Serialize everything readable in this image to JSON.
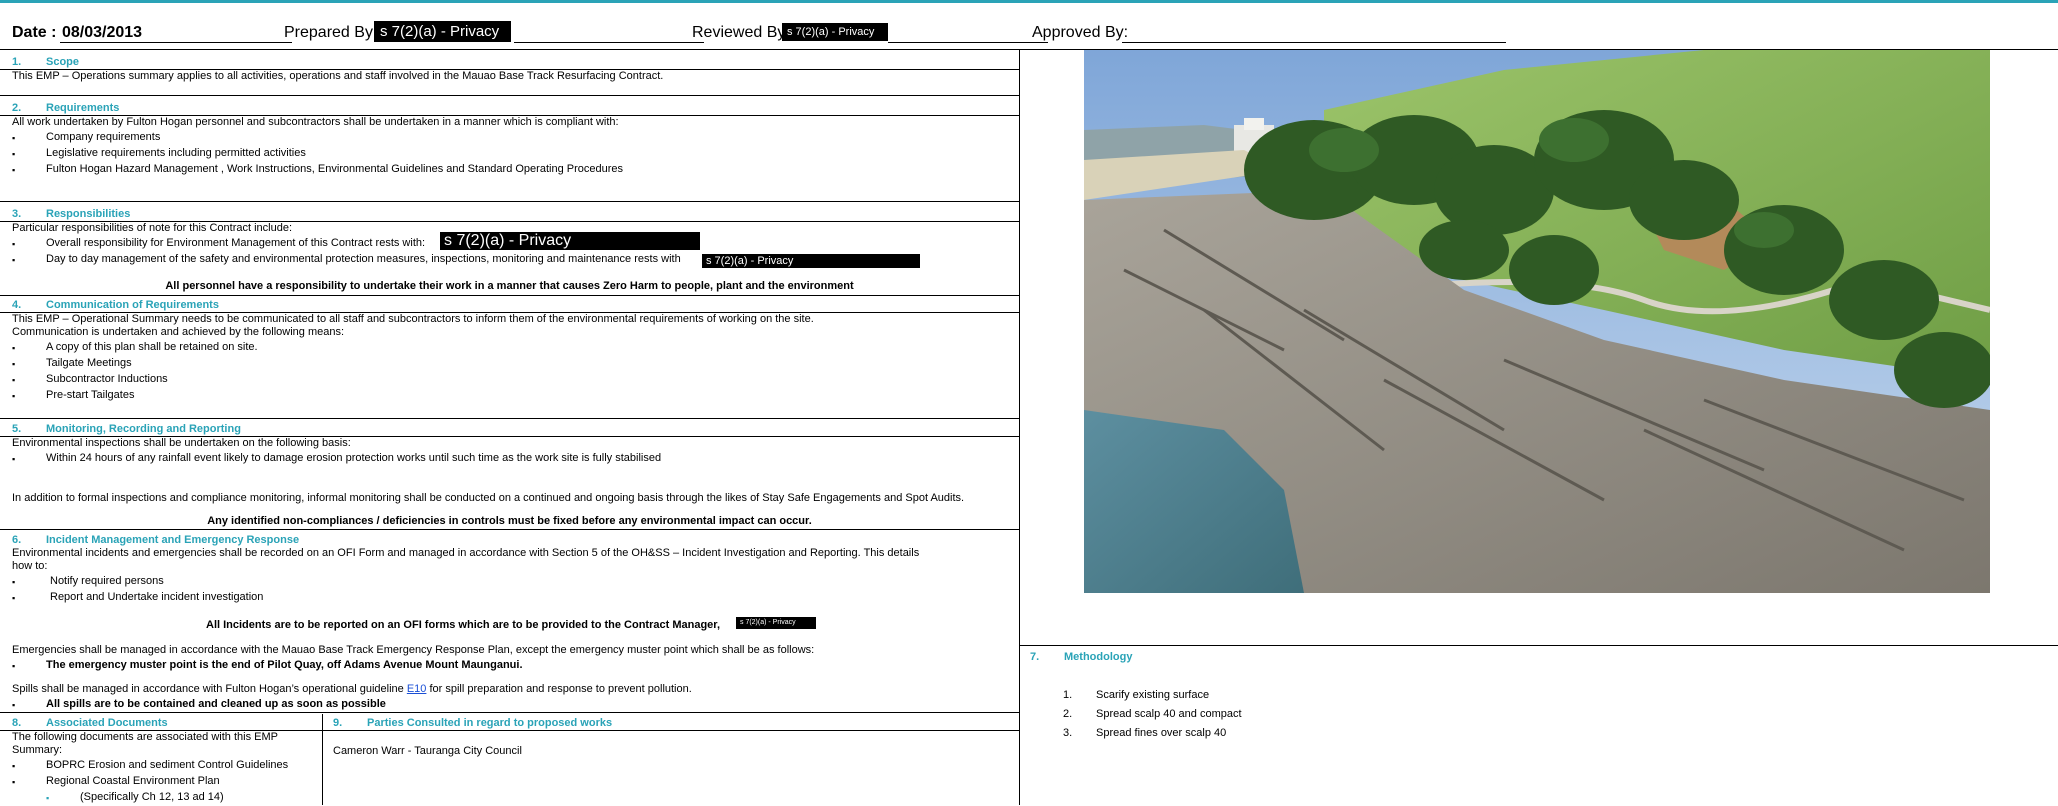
{
  "header": {
    "date_label": "Date :",
    "date_value": "08/03/2013",
    "prepared_label": "Prepared By:",
    "prepared_redaction": "s 7(2)(a) - Privacy",
    "reviewed_label": "Reviewed By",
    "reviewed_redaction": "s 7(2)(a) - Privacy",
    "approved_label": "Approved By:"
  },
  "sections": {
    "scope": {
      "num": "1.",
      "title": "Scope",
      "text": "This EMP – Operations summary applies to all activities, operations and staff involved in the Mauao Base Track Resurfacing Contract."
    },
    "requirements": {
      "num": "2.",
      "title": "Requirements",
      "intro": "All work undertaken by Fulton Hogan personnel and subcontractors shall be undertaken in a manner which is compliant with:",
      "items": [
        "Company requirements",
        "Legislative requirements including permitted activities",
        "Fulton Hogan Hazard Management , Work Instructions, Environmental Guidelines and Standard Operating Procedures"
      ]
    },
    "responsibilities": {
      "num": "3.",
      "title": "Responsibilities",
      "intro": "Particular responsibilities of note for this Contract include:",
      "items": [
        "Overall responsibility for Environment Management of this Contract rests with:",
        "Day to day management of the safety and environmental protection measures, inspections, monitoring and maintenance rests with"
      ],
      "redaction1": "s 7(2)(a) - Privacy",
      "redaction2": "s 7(2)(a) - Privacy",
      "statement": "All personnel have a responsibility to undertake their work in a manner that causes Zero Harm to people, plant and the environment"
    },
    "communication": {
      "num": "4.",
      "title": "Communication of Requirements",
      "line1": "This EMP – Operational Summary needs to be communicated to all staff and subcontractors to inform them of the environmental requirements of working on the site.",
      "line2": "Communication is undertaken and achieved by the following means:",
      "items": [
        "A copy of this plan shall be retained on site.",
        "Tailgate Meetings",
        "Subcontractor Inductions",
        "Pre-start Tailgates"
      ]
    },
    "monitoring": {
      "num": "5.",
      "title": "Monitoring, Recording and Reporting",
      "intro": "Environmental inspections shall be undertaken on the following basis:",
      "items": [
        "Within 24 hours of any rainfall event likely to damage erosion protection works until such time as the work site is fully stabilised"
      ],
      "para": "In addition to formal inspections and compliance monitoring, informal monitoring shall be conducted on a continued and ongoing basis through the likes of Stay Safe Engagements and Spot Audits.",
      "statement": "Any identified non-compliances / deficiencies in controls must be fixed before any environmental impact can occur."
    },
    "incident": {
      "num": "6.",
      "title": "Incident Management and Emergency Response",
      "line1": "Environmental incidents and emergencies shall be recorded on an OFI Form and managed in accordance with Section 5 of the OH&SS – Incident Investigation and Reporting. This details",
      "line2": "how to:",
      "items": [
        "Notify required persons",
        "Report and  Undertake incident investigation"
      ],
      "statement": "All Incidents are to be reported on an OFI forms which are to be provided to the Contract Manager,",
      "redaction": "s 7(2)(a) - Privacy",
      "emergency": "Emergencies shall be managed in accordance with the Mauao Base Track Emergency Response Plan, except the emergency muster point which shall be as follows:",
      "muster": "The emergency muster point is the end of Pilot Quay, off Adams Avenue Mount Maunganui.",
      "spills_pre": "Spills shall be managed in accordance with Fulton Hogan’s operational guideline ",
      "spills_link": "E10",
      "spills_post": " for spill preparation and response to prevent pollution.",
      "spills_bullet": "All spills are to be contained and cleaned up as soon as possible"
    },
    "associated": {
      "num": "8.",
      "title": "Associated Documents",
      "line1": "The following documents are associated with this EMP",
      "line2": "Summary:",
      "items": [
        "BOPRC Erosion and sediment Control Guidelines",
        "Regional Coastal Environment Plan"
      ],
      "subitem": "(Specifically Ch 12, 13 ad 14)"
    },
    "consulted": {
      "num": "9.",
      "title": "Parties Consulted in regard to proposed works",
      "text": "Cameron Warr - Tauranga City Council"
    },
    "methodology": {
      "num": "7.",
      "title": "Methodology",
      "steps": [
        {
          "n": "1.",
          "t": "Scarify existing surface"
        },
        {
          "n": "2.",
          "t": "Spread scalp 40 and compact"
        },
        {
          "n": "3.",
          "t": "Spread fines over scalp 40"
        }
      ]
    }
  },
  "bullet_glyph": "▪",
  "colors": {
    "heading": "#2aa3b7",
    "link": "#1a4fd6"
  }
}
